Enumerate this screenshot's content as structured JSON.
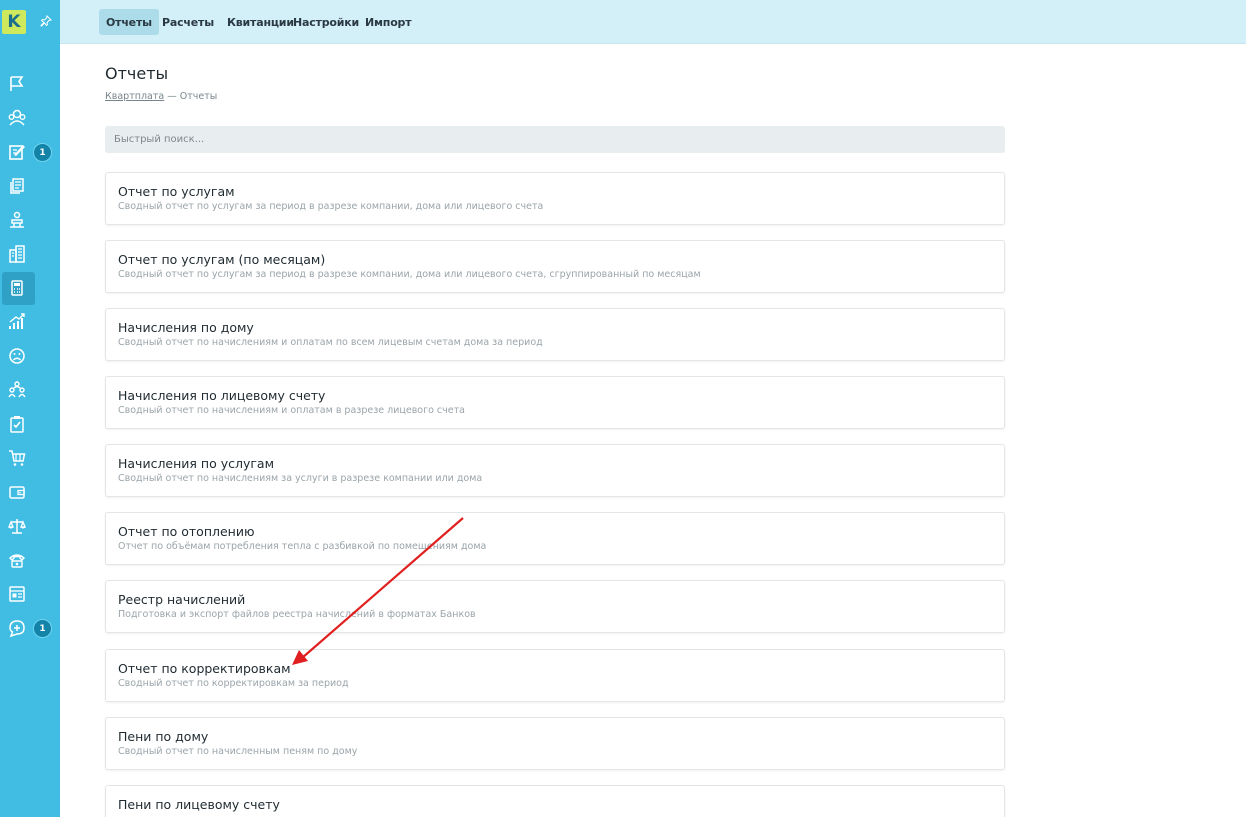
{
  "sidebar": {
    "logo_text": "K",
    "pin_icon": "pin-icon",
    "icons": [
      {
        "name": "flag-icon",
        "badge": null
      },
      {
        "name": "users-group-icon",
        "badge": null
      },
      {
        "name": "edit-document-icon",
        "badge": "1"
      },
      {
        "name": "documents-icon",
        "badge": null
      },
      {
        "name": "worker-icon",
        "badge": null
      },
      {
        "name": "buildings-icon",
        "badge": null
      },
      {
        "name": "calculator-icon",
        "badge": null,
        "active": true
      },
      {
        "name": "chart-growth-icon",
        "badge": null
      },
      {
        "name": "sad-face-icon",
        "badge": null
      },
      {
        "name": "people-hierarchy-icon",
        "badge": null
      },
      {
        "name": "clipboard-check-icon",
        "badge": null
      },
      {
        "name": "cart-icon",
        "badge": null
      },
      {
        "name": "wallet-icon",
        "badge": null
      },
      {
        "name": "scales-icon",
        "badge": null
      },
      {
        "name": "phone-icon",
        "badge": null
      },
      {
        "name": "id-card-icon",
        "badge": null
      },
      {
        "name": "chat-add-icon",
        "badge": "1"
      }
    ],
    "badge_3": "1",
    "badge_17": "1"
  },
  "topnav": {
    "tabs": [
      {
        "label": "Отчеты",
        "active": true
      },
      {
        "label": "Расчеты",
        "active": false
      },
      {
        "label": "Квитанции",
        "active": false
      },
      {
        "label": "Настройки",
        "active": false
      },
      {
        "label": "Импорт",
        "active": false
      }
    ]
  },
  "page": {
    "title": "Отчеты",
    "breadcrumb_link": "Квартплата",
    "breadcrumb_sep": " — ",
    "breadcrumb_current": "Отчеты",
    "search_placeholder": "Быстрый поиск..."
  },
  "reports": [
    {
      "title": "Отчет по услугам",
      "desc": "Сводный отчет по услугам за период в разрезе компании, дома или лицевого счета"
    },
    {
      "title": "Отчет по услугам (по месяцам)",
      "desc": "Сводный отчет по услугам за период в разрезе компании, дома или лицевого счета, сгруппированный по месяцам"
    },
    {
      "title": "Начисления по дому",
      "desc": "Сводный отчет по начислениям и оплатам по всем лицевым счетам дома за период"
    },
    {
      "title": "Начисления по лицевому счету",
      "desc": "Сводный отчет по начислениям и оплатам в разрезе лицевого счета"
    },
    {
      "title": "Начисления по услугам",
      "desc": "Сводный отчет по начислениям за услуги в разрезе компании или дома"
    },
    {
      "title": "Отчет по отоплению",
      "desc": "Отчет по объёмам потребления тепла с разбивкой по помещениям дома"
    },
    {
      "title": "Реестр начислений",
      "desc": "Подготовка и экспорт файлов реестра начислений в форматах Банков"
    },
    {
      "title": "Отчет по корректировкам",
      "desc": "Сводный отчет по корректировкам за период"
    },
    {
      "title": "Пени по дому",
      "desc": "Сводный отчет по начисленным пеням по дому"
    },
    {
      "title": "Пени по лицевому счету",
      "desc": ""
    }
  ],
  "annotation": {
    "arrow_color": "#e02020"
  }
}
